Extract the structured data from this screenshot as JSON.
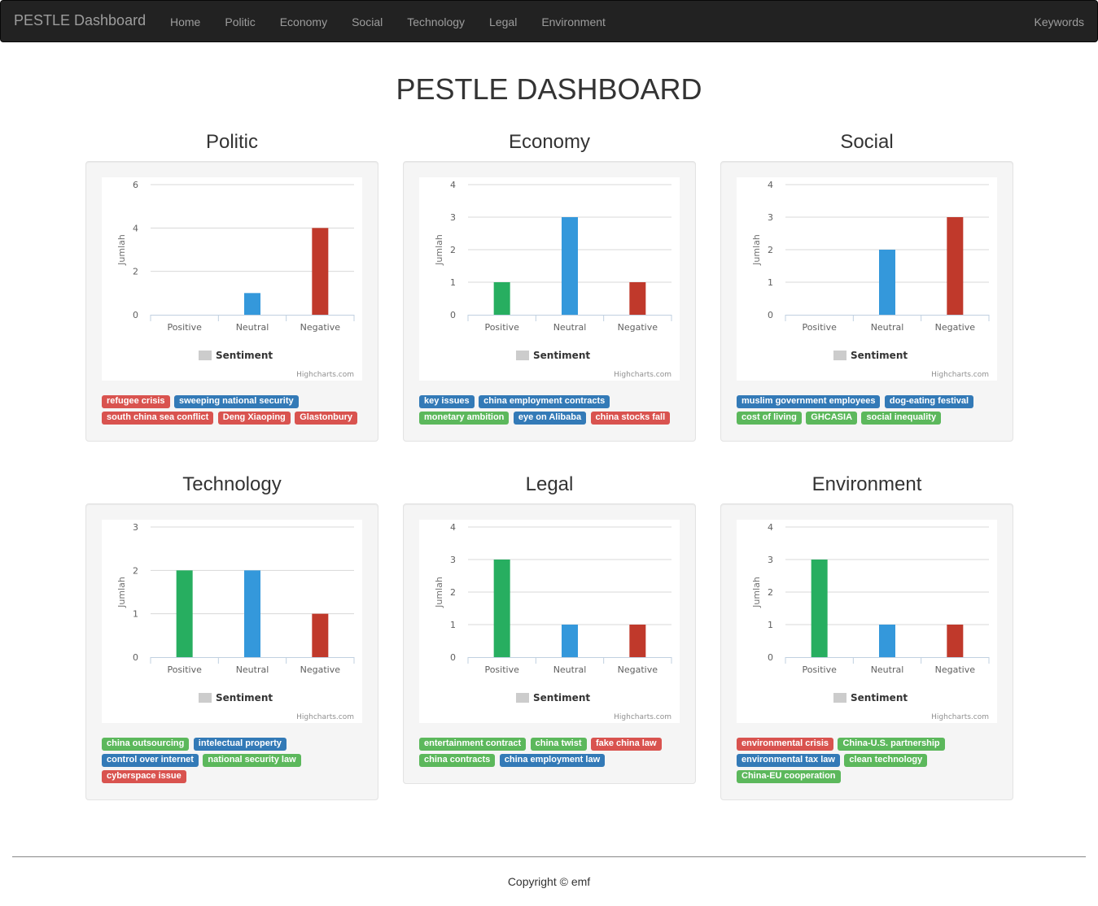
{
  "nav": {
    "brand": "PESTLE Dashboard",
    "items": [
      {
        "label": "Home"
      },
      {
        "label": "Politic"
      },
      {
        "label": "Economy"
      },
      {
        "label": "Social"
      },
      {
        "label": "Technology"
      },
      {
        "label": "Legal"
      },
      {
        "label": "Environment"
      }
    ],
    "right_label": "Keywords"
  },
  "page_title": "PESTLE DASHBOARD",
  "colors": {
    "positive": "#27ae60",
    "neutral": "#3498db",
    "negative": "#c0392b",
    "tag_red": "#d9534f",
    "tag_blue": "#337ab7",
    "tag_green": "#5cb85c",
    "legend_swatch": "#cccccc"
  },
  "chart_data": [
    {
      "type": "bar",
      "title": "Politic",
      "categories": [
        "Positive",
        "Neutral",
        "Negative"
      ],
      "values": [
        0,
        1,
        4
      ],
      "ylabel": "Jumlah",
      "ylim": [
        0,
        6
      ],
      "yticks": [
        0,
        2,
        4,
        6
      ],
      "legend": "Sentiment",
      "credit": "Highcharts.com",
      "grid": true,
      "legend_position": "bottom"
    },
    {
      "type": "bar",
      "title": "Economy",
      "categories": [
        "Positive",
        "Neutral",
        "Negative"
      ],
      "values": [
        1,
        3,
        1
      ],
      "ylabel": "Jumlah",
      "ylim": [
        0,
        4
      ],
      "yticks": [
        0,
        1,
        2,
        3,
        4
      ],
      "legend": "Sentiment",
      "credit": "Highcharts.com",
      "grid": true,
      "legend_position": "bottom"
    },
    {
      "type": "bar",
      "title": "Social",
      "categories": [
        "Positive",
        "Neutral",
        "Negative"
      ],
      "values": [
        0,
        2,
        3
      ],
      "ylabel": "Jumlah",
      "ylim": [
        0,
        4
      ],
      "yticks": [
        0,
        1,
        2,
        3,
        4
      ],
      "legend": "Sentiment",
      "credit": "Highcharts.com",
      "grid": true,
      "legend_position": "bottom"
    },
    {
      "type": "bar",
      "title": "Technology",
      "categories": [
        "Positive",
        "Neutral",
        "Negative"
      ],
      "values": [
        2,
        2,
        1
      ],
      "ylabel": "Jumlah",
      "ylim": [
        0,
        3
      ],
      "yticks": [
        0,
        1,
        2,
        3
      ],
      "legend": "Sentiment",
      "credit": "Highcharts.com",
      "grid": true,
      "legend_position": "bottom"
    },
    {
      "type": "bar",
      "title": "Legal",
      "categories": [
        "Positive",
        "Neutral",
        "Negative"
      ],
      "values": [
        3,
        1,
        1
      ],
      "ylabel": "Jumlah",
      "ylim": [
        0,
        4
      ],
      "yticks": [
        0,
        1,
        2,
        3,
        4
      ],
      "legend": "Sentiment",
      "credit": "Highcharts.com",
      "grid": true,
      "legend_position": "bottom"
    },
    {
      "type": "bar",
      "title": "Environment",
      "categories": [
        "Positive",
        "Neutral",
        "Negative"
      ],
      "values": [
        3,
        1,
        1
      ],
      "ylabel": "Jumlah",
      "ylim": [
        0,
        4
      ],
      "yticks": [
        0,
        1,
        2,
        3,
        4
      ],
      "legend": "Sentiment",
      "credit": "Highcharts.com",
      "grid": true,
      "legend_position": "bottom"
    }
  ],
  "keywords": [
    [
      {
        "text": "refugee crisis",
        "color": "red"
      },
      {
        "text": "sweeping national security",
        "color": "blue"
      },
      {
        "text": "south china sea conflict",
        "color": "red"
      },
      {
        "text": "Deng Xiaoping",
        "color": "red"
      },
      {
        "text": "Glastonbury",
        "color": "red"
      }
    ],
    [
      {
        "text": "key issues",
        "color": "blue"
      },
      {
        "text": "china employment contracts",
        "color": "blue"
      },
      {
        "text": "monetary ambition",
        "color": "green"
      },
      {
        "text": "eye on Alibaba",
        "color": "blue"
      },
      {
        "text": "china stocks fall",
        "color": "red"
      }
    ],
    [
      {
        "text": "muslim government employees",
        "color": "blue"
      },
      {
        "text": "dog-eating festival",
        "color": "blue"
      },
      {
        "text": "cost of living",
        "color": "green"
      },
      {
        "text": "GHCASIA",
        "color": "green"
      },
      {
        "text": "social inequality",
        "color": "green"
      }
    ],
    [
      {
        "text": "china outsourcing",
        "color": "green"
      },
      {
        "text": "intelectual property",
        "color": "blue"
      },
      {
        "text": "control over internet",
        "color": "blue"
      },
      {
        "text": "national security law",
        "color": "green"
      },
      {
        "text": "cyberspace issue",
        "color": "red"
      }
    ],
    [
      {
        "text": "entertainment contract",
        "color": "green"
      },
      {
        "text": "china twist",
        "color": "green"
      },
      {
        "text": "fake china law",
        "color": "red"
      },
      {
        "text": "china contracts",
        "color": "green"
      },
      {
        "text": "china employment law",
        "color": "blue"
      }
    ],
    [
      {
        "text": "environmental crisis",
        "color": "red"
      },
      {
        "text": "China-U.S. partnership",
        "color": "green"
      },
      {
        "text": "environmental tax law",
        "color": "blue"
      },
      {
        "text": "clean technology",
        "color": "green"
      },
      {
        "text": "China-EU cooperation",
        "color": "green"
      }
    ]
  ],
  "footer": {
    "copyright": "Copyright © emf"
  }
}
